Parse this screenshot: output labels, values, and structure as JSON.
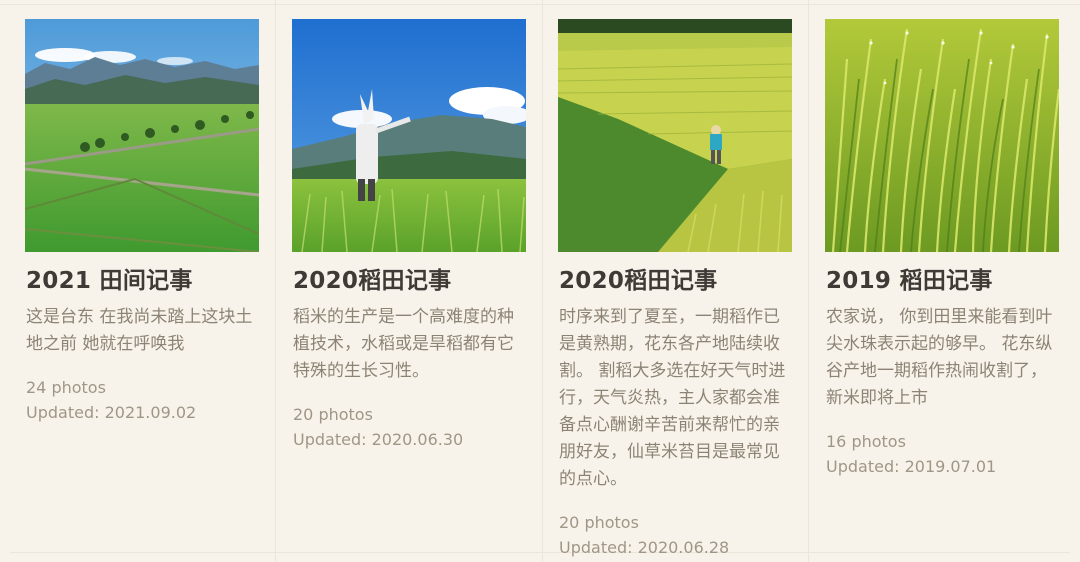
{
  "albums": [
    {
      "title": "2021 田间记事",
      "description": "这是台东 在我尚未踏上这块土地之前 她就在呼唤我",
      "photos": "24 photos",
      "updated": "Updated: 2021.09.02",
      "image": "mountain-rice-fields"
    },
    {
      "title": "2020稻田记事",
      "description": "稻米的生产是一个高难度的种植技术，水稻或是旱稻都有它特殊的生长习性。",
      "photos": "20 photos",
      "updated": "Updated: 2020.06.30",
      "image": "scarecrow-in-rice-field"
    },
    {
      "title": "2020稻田记事",
      "description": "时序来到了夏至，一期稻作已是黄熟期，花东各产地陆续收割。 割稻大多选在好天气时进行，天气炎热，主人家都会准备点心酬谢辛苦前来帮忙的亲朋好友，仙草米苔目是最常见的点心。",
      "photos": "20 photos",
      "updated": "Updated: 2020.06.28",
      "image": "farmer-walking-ripe-rice"
    },
    {
      "title": "2019 稻田记事",
      "description": "农家说， 你到田里来能看到叶尖水珠表示起的够早。 花东纵谷产地一期稻作热闹收割了， 新米即将上市",
      "photos": "16 photos",
      "updated": "Updated: 2019.07.01",
      "image": "rice-leaves-closeup"
    }
  ]
}
